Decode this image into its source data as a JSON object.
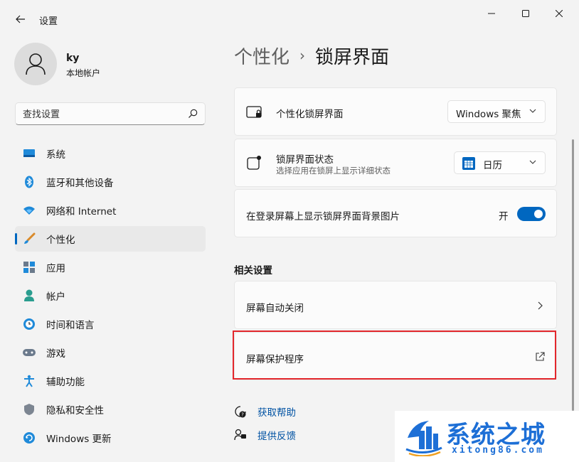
{
  "window": {
    "title": "设置"
  },
  "user": {
    "name": "ky",
    "account_type": "本地帐户"
  },
  "search": {
    "placeholder": "查找设置"
  },
  "nav": {
    "items": [
      {
        "label": "系统",
        "icon": "system-icon"
      },
      {
        "label": "蓝牙和其他设备",
        "icon": "bluetooth-icon"
      },
      {
        "label": "网络和 Internet",
        "icon": "network-icon"
      },
      {
        "label": "个性化",
        "icon": "personalization-icon",
        "active": true
      },
      {
        "label": "应用",
        "icon": "apps-icon"
      },
      {
        "label": "帐户",
        "icon": "accounts-icon"
      },
      {
        "label": "时间和语言",
        "icon": "time-language-icon"
      },
      {
        "label": "游戏",
        "icon": "gaming-icon"
      },
      {
        "label": "辅助功能",
        "icon": "accessibility-icon"
      },
      {
        "label": "隐私和安全性",
        "icon": "privacy-icon"
      },
      {
        "label": "Windows 更新",
        "icon": "windows-update-icon"
      }
    ]
  },
  "breadcrumb": {
    "parent": "个性化",
    "separator": "›",
    "current": "锁屏界面"
  },
  "settings": {
    "personalize_lock": {
      "title": "个性化锁屏界面",
      "value": "Windows 聚焦"
    },
    "lock_status": {
      "title": "锁屏界面状态",
      "subtitle": "选择应用在锁屏上显示详细状态",
      "value": "日历"
    },
    "signin_background": {
      "title": "在登录屏幕上显示锁屏界面背景图片",
      "state_label": "开",
      "on": true
    }
  },
  "related": {
    "title": "相关设置",
    "items": [
      {
        "label": "屏幕自动关闭"
      },
      {
        "label": "屏幕保护程序"
      }
    ]
  },
  "help": {
    "get_help": "获取帮助",
    "feedback": "提供反馈"
  },
  "watermark": {
    "title": "系统之城",
    "url": "xitong86.com"
  },
  "colors": {
    "accent": "#0067c0",
    "highlight": "#e3272c",
    "watermark": "#1d6fd6"
  }
}
